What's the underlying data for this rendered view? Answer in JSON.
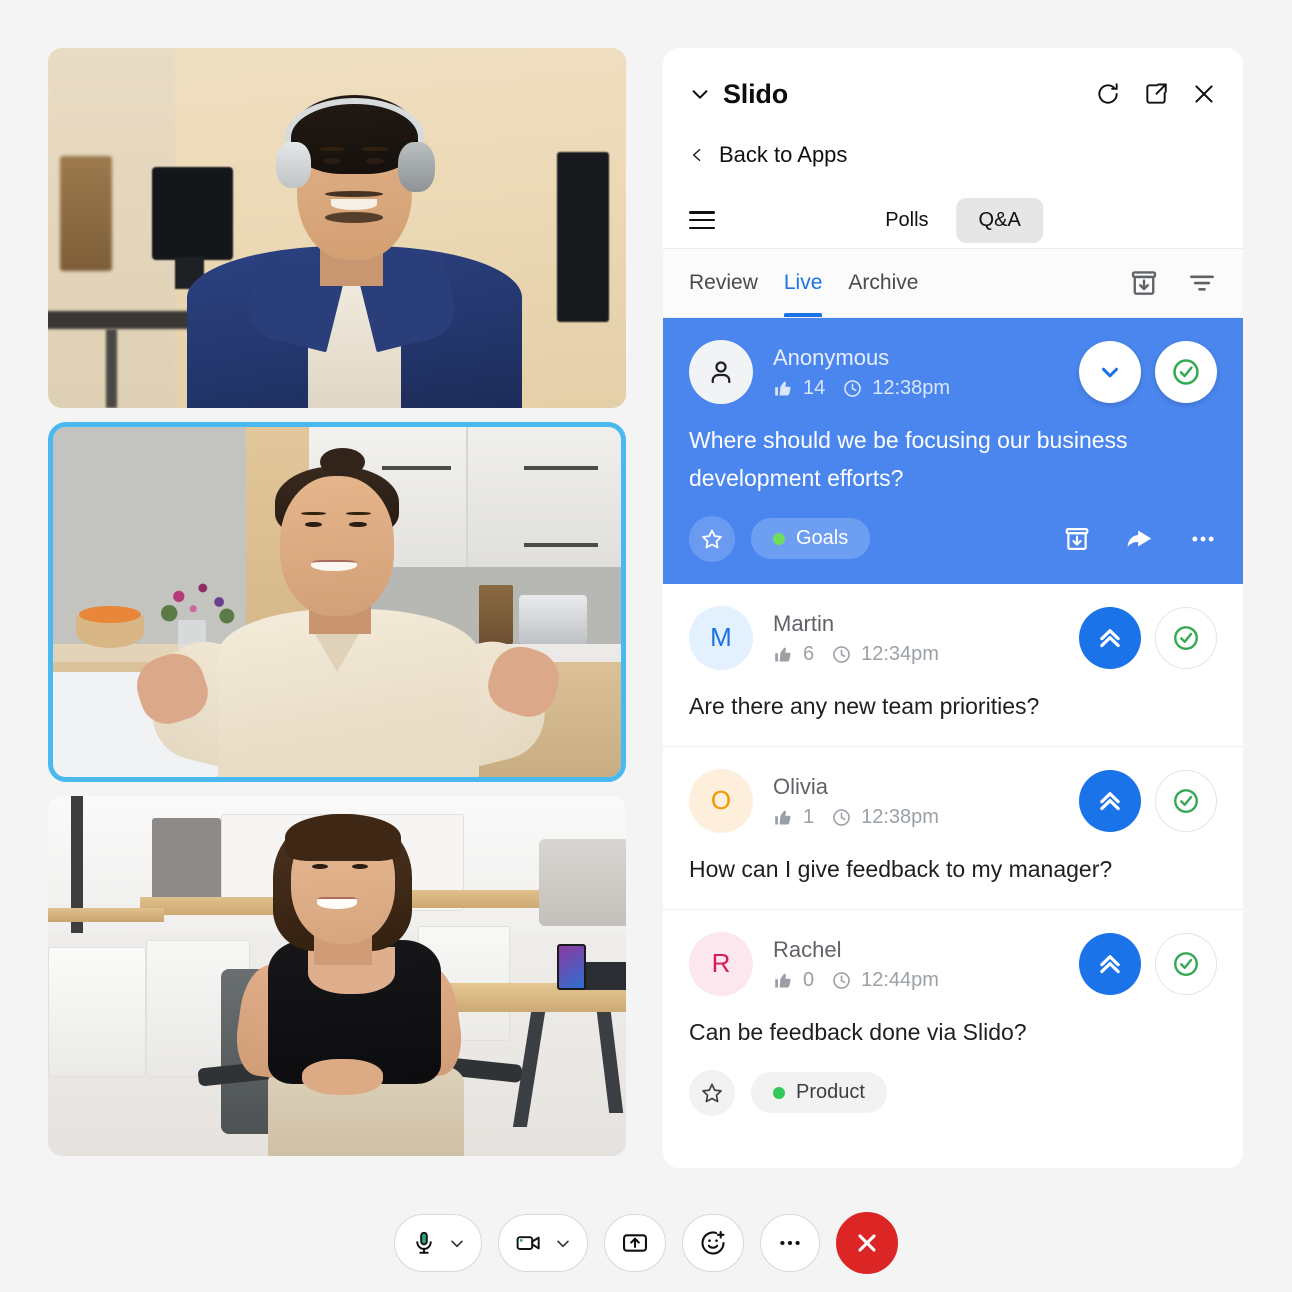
{
  "panel": {
    "app_title": "Slido",
    "collapse_icon": "chevron-down-icon",
    "refresh_icon": "refresh-icon",
    "popout_icon": "pop-out-icon",
    "close_icon": "close-icon",
    "back_label": "Back to Apps",
    "menu_icon": "hamburger-menu-icon",
    "segments": [
      {
        "label": "Polls",
        "active": false
      },
      {
        "label": "Q&A",
        "active": true
      }
    ],
    "subtabs": [
      {
        "label": "Review",
        "active": false
      },
      {
        "label": "Live",
        "active": true
      },
      {
        "label": "Archive",
        "active": false
      }
    ],
    "subtab_actions": [
      {
        "name": "archive-icon"
      },
      {
        "name": "filter-icon"
      }
    ]
  },
  "questions": [
    {
      "author": "Anonymous",
      "avatar_letter": "",
      "avatar_type": "anonymous",
      "likes": "14",
      "time": "12:38pm",
      "text": "Where should we be focusing our business development efforts?",
      "tag": "Goals",
      "featured": true,
      "primary_action": "chevron-down-icon",
      "secondary_action": "check-circle-icon",
      "footer_actions": [
        "archive-icon",
        "reply-icon",
        "more-icon"
      ]
    },
    {
      "author": "Martin",
      "avatar_letter": "M",
      "avatar_type": "letter",
      "avatar_bg": "#e3f0fd",
      "avatar_fg": "#1a73e8",
      "likes": "6",
      "time": "12:34pm",
      "text": "Are there any new team priorities?",
      "tag": "",
      "featured": false,
      "primary_action": "upvote-icon",
      "secondary_action": "check-circle-icon"
    },
    {
      "author": "Olivia",
      "avatar_letter": "O",
      "avatar_type": "letter",
      "avatar_bg": "#fdefdc",
      "avatar_fg": "#f29900",
      "likes": "1",
      "time": "12:38pm",
      "text": "How can I give feedback to my manager?",
      "tag": "",
      "featured": false,
      "primary_action": "upvote-icon",
      "secondary_action": "check-circle-icon"
    },
    {
      "author": "Rachel",
      "avatar_letter": "R",
      "avatar_type": "letter",
      "avatar_bg": "#fce7ee",
      "avatar_fg": "#d81b60",
      "likes": "0",
      "time": "12:44pm",
      "text": "Can be feedback done via Slido?",
      "tag": "Product",
      "featured": false,
      "primary_action": "upvote-icon",
      "secondary_action": "check-circle-icon"
    }
  ],
  "video_tiles": [
    {
      "name": "participant-tile-1",
      "description": "Man wearing headphones in a warm-lit office",
      "active_speaker": false
    },
    {
      "name": "participant-tile-2",
      "description": "Woman gesturing while speaking in a kitchen",
      "active_speaker": true
    },
    {
      "name": "participant-tile-3",
      "description": "Woman smiling in an open-plan office",
      "active_speaker": false
    }
  ],
  "toolbar": [
    {
      "name": "microphone-button",
      "icon": "microphone-icon",
      "has_dropdown": true
    },
    {
      "name": "camera-button",
      "icon": "camera-icon",
      "has_dropdown": true
    },
    {
      "name": "share-screen-button",
      "icon": "share-screen-icon",
      "has_dropdown": false
    },
    {
      "name": "reactions-button",
      "icon": "smiley-plus-icon",
      "has_dropdown": false
    },
    {
      "name": "more-options-button",
      "icon": "more-horizontal-icon",
      "has_dropdown": false
    },
    {
      "name": "end-call-button",
      "icon": "close-icon",
      "has_dropdown": false
    }
  ],
  "colors": {
    "accent_blue": "#1a73e8",
    "featured_card": "#4a86ee",
    "active_speaker_border": "#4ab9ef",
    "end_call_red": "#dc2626",
    "tag_dot_green": "#34c759",
    "page_background": "#f4f4f4"
  }
}
